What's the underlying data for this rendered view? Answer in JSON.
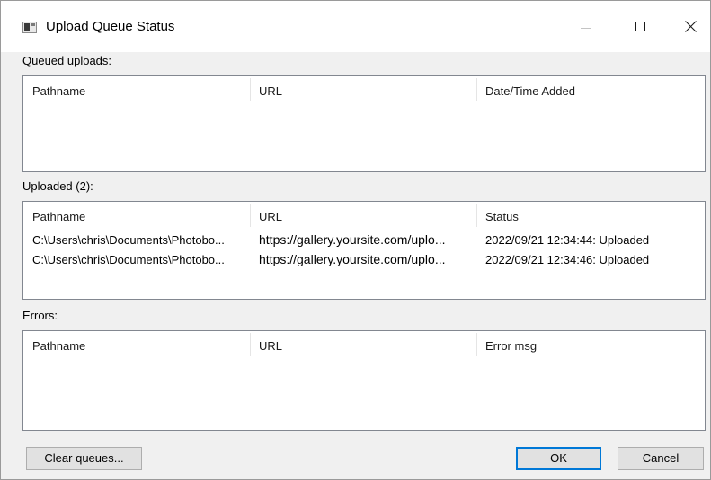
{
  "window": {
    "title": "Upload Queue Status"
  },
  "queued": {
    "label": "Queued uploads:",
    "columns": [
      "Pathname",
      "URL",
      "Date/Time Added"
    ],
    "rows": []
  },
  "uploaded": {
    "label": "Uploaded (2):",
    "columns": [
      "Pathname",
      "URL",
      "Status"
    ],
    "rows": [
      [
        "C:\\Users\\chris\\Documents\\Photobo...",
        "https://gallery.yoursite.com/uplo...",
        "2022/09/21 12:34:44: Uploaded"
      ],
      [
        "C:\\Users\\chris\\Documents\\Photobo...",
        "https://gallery.yoursite.com/uplo...",
        "2022/09/21 12:34:46: Uploaded"
      ]
    ]
  },
  "errors": {
    "label": "Errors:",
    "columns": [
      "Pathname",
      "URL",
      "Error msg"
    ],
    "rows": []
  },
  "buttons": {
    "clear": "Clear queues...",
    "ok": "OK",
    "cancel": "Cancel"
  },
  "icons": {
    "app": "app-window-icon",
    "minimize": "minimize-icon",
    "maximize": "maximize-icon",
    "close": "close-icon"
  }
}
